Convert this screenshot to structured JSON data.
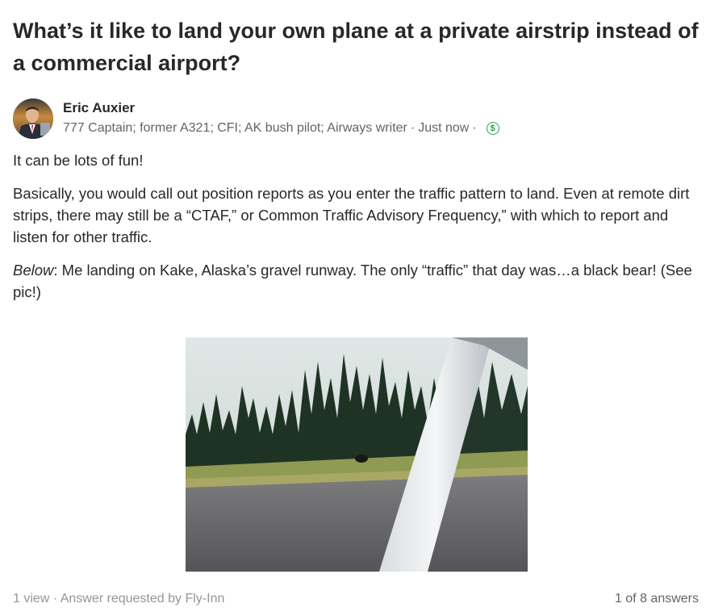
{
  "question": {
    "title": "What’s it like to land your own plane at a private airstrip instead of a commercial airport?"
  },
  "author": {
    "name": "Eric Auxier",
    "credentials": "777 Captain; former A321; CFI; AK bush pilot; Airways writer",
    "timestamp": "Just now",
    "separator": "·",
    "badge_icon": "dollar-circle-icon",
    "badge_color": "#2e9e56"
  },
  "answer": {
    "paragraph1": "It can be lots of fun!",
    "paragraph2": "Basically, you would call out position reports as you enter the traffic pattern to land. Even at remote dirt strips, there may still be a “CTAF,” or Common Traffic Advisory Frequency,” with which to report and listen for other traffic.",
    "paragraph3_emphasis": "Below",
    "paragraph3_rest": ": Me landing on Kake, Alaska’s gravel runway. The only “traffic” that day was…a black bear! (See pic!)"
  },
  "footer": {
    "views": "1 view",
    "separator": "·",
    "requested_prefix": "Answer requested by",
    "requested_by": "Fly-Inn",
    "answer_position": "1 of 8 answers"
  }
}
